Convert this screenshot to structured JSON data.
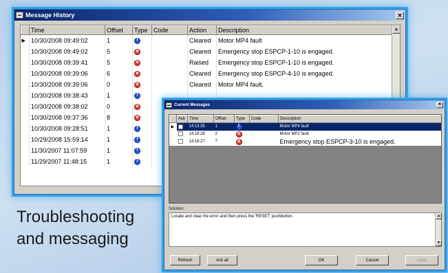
{
  "history": {
    "title": "Message History",
    "columns": [
      "Time",
      "Offset",
      "Type",
      "Code",
      "Action",
      "Description"
    ],
    "rows": [
      {
        "time": "10/30/2008 09:49:02",
        "offset": "1",
        "type": "info",
        "code": "",
        "action": "Cleared",
        "description": "Motor MP4 fault"
      },
      {
        "time": "10/30/2008 09:49:02",
        "offset": "5",
        "type": "error",
        "code": "",
        "action": "Cleared",
        "description": "Emergency stop ESPCP-1-10 is engaged."
      },
      {
        "time": "10/30/2008 09:39:41",
        "offset": "5",
        "type": "error",
        "code": "",
        "action": "Raised",
        "description": "Emergency stop ESPCP-1-10 is engaged."
      },
      {
        "time": "10/30/2008 09:39:06",
        "offset": "6",
        "type": "error",
        "code": "",
        "action": "Cleared",
        "description": "Emergency stop ESPCP-4-10 is engaged."
      },
      {
        "time": "10/30/2008 09:39:06",
        "offset": "0",
        "type": "error",
        "code": "",
        "action": "Cleared",
        "description": "Motor MP4 fault."
      },
      {
        "time": "10/30/2008 09:38:43",
        "offset": "1",
        "type": "info",
        "code": "",
        "action": "",
        "description": ""
      },
      {
        "time": "10/30/2008 09:38:02",
        "offset": "0",
        "type": "error",
        "code": "",
        "action": "",
        "description": ""
      },
      {
        "time": "10/30/2008 09:37:36",
        "offset": "8",
        "type": "error",
        "code": "",
        "action": "",
        "description": ""
      },
      {
        "time": "10/30/2008 09:28:51",
        "offset": "1",
        "type": "info",
        "code": "",
        "action": "",
        "description": ""
      },
      {
        "time": "10/29/2008 15:59:14",
        "offset": "1",
        "type": "info",
        "code": "",
        "action": "",
        "description": ""
      },
      {
        "time": "11/30/2007 11:07:59",
        "offset": "1",
        "type": "info",
        "code": "",
        "action": "",
        "description": ""
      },
      {
        "time": "11/29/2007 11:48:15",
        "offset": "1",
        "type": "info",
        "code": "",
        "action": "",
        "description": ""
      }
    ]
  },
  "current": {
    "title": "Current Messages",
    "columns": [
      "Ack",
      "Time",
      "Offset",
      "Type",
      "Code",
      "Description"
    ],
    "rows": [
      {
        "time": "14:13:35",
        "offset": "1",
        "type": "info",
        "code": "",
        "description": "Motor MP4 fault",
        "selected": true
      },
      {
        "time": "14:18:28",
        "offset": "2",
        "type": "error",
        "code": "",
        "description": "Motor MP2 fault",
        "selected": false
      },
      {
        "time": "14:18:27",
        "offset": "7",
        "type": "error",
        "code": "",
        "description": "Emergency stop ESPCP-3-10 is engaged.",
        "selected": false
      }
    ],
    "solution_label": "Solution",
    "solution_text": "Locate and clear the error and then press the 'RESET' pushbutton.",
    "buttons": {
      "refresh": "Refresh",
      "ack_all": "Ack all",
      "ok": "OK",
      "cancel": "Cancel",
      "apply": "Apply"
    }
  },
  "caption": {
    "line1": "Troubleshooting",
    "line2": "and messaging"
  },
  "colors": {
    "title_bar": "#0a246a",
    "glow": "#2fa3e8",
    "selection": "#0a246a"
  }
}
